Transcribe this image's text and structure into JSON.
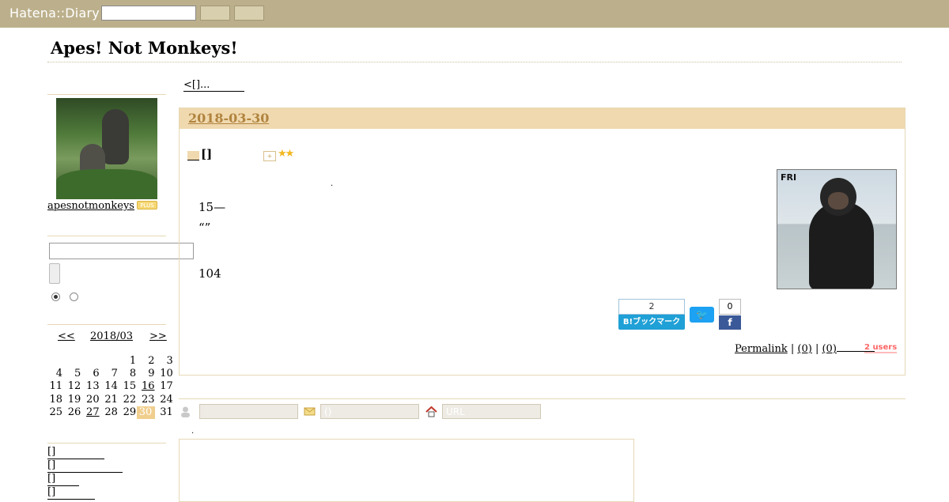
{
  "header": {
    "logo": "Hatena::Diary",
    "search_value": ""
  },
  "blog": {
    "title": "Apes! Not Monkeys!"
  },
  "sidebar": {
    "username": "apesnotmonkeys",
    "plus_badge": "PLUS",
    "search_value": "",
    "calendar": {
      "prev": "<<",
      "month": "2018/03",
      "next": ">>",
      "days": [
        {
          "d": "1"
        },
        {
          "d": "2"
        },
        {
          "d": "3"
        },
        {
          "d": "4"
        },
        {
          "d": "5"
        },
        {
          "d": "6"
        },
        {
          "d": "7"
        },
        {
          "d": "8"
        },
        {
          "d": "9"
        },
        {
          "d": "10"
        },
        {
          "d": "11"
        },
        {
          "d": "12"
        },
        {
          "d": "13"
        },
        {
          "d": "14"
        },
        {
          "d": "15"
        },
        {
          "d": "16",
          "link": true
        },
        {
          "d": "17"
        },
        {
          "d": "18"
        },
        {
          "d": "19"
        },
        {
          "d": "20"
        },
        {
          "d": "21"
        },
        {
          "d": "22"
        },
        {
          "d": "23"
        },
        {
          "d": "24"
        },
        {
          "d": "25"
        },
        {
          "d": "26"
        },
        {
          "d": "27",
          "link": true
        },
        {
          "d": "28"
        },
        {
          "d": "29"
        },
        {
          "d": "30",
          "today": true
        },
        {
          "d": "31"
        }
      ]
    },
    "links": [
      "[]",
      "[]",
      "[]",
      "[]"
    ]
  },
  "main": {
    "nav_prev": "<[]...",
    "entry": {
      "date": "2018-03-30",
      "section_title": "[]",
      "star_add_icon": "star-add-icon",
      "stars": "★★",
      "dot": ".",
      "lines": [
        "15—",
        "“”",
        "104"
      ],
      "photo_label": "FRI",
      "hatena_bookmark": {
        "count": "2",
        "label": "B!ブックマーク"
      },
      "twitter_icon": "twitter-bird-icon",
      "facebook": {
        "count": "0",
        "icon": "f"
      },
      "footer": {
        "permalink": "Permalink",
        "sep": "|",
        "comments": "(0)",
        "trackbacks": "(0)",
        "users": "2 users"
      }
    }
  },
  "comment_form": {
    "name_value": "",
    "mail_placeholder": "()",
    "url_placeholder": "URL",
    "dot": "."
  },
  "colors": {
    "header_bg": "#bcb08c",
    "date_bar_bg": "#f0d9af",
    "date_text": "#b0833e",
    "today_bg": "#f0cf8e",
    "hatena_blue": "#1fa0d6",
    "twitter_blue": "#1da1f2",
    "facebook_blue": "#3b5998",
    "users_red": "#ff6666"
  }
}
